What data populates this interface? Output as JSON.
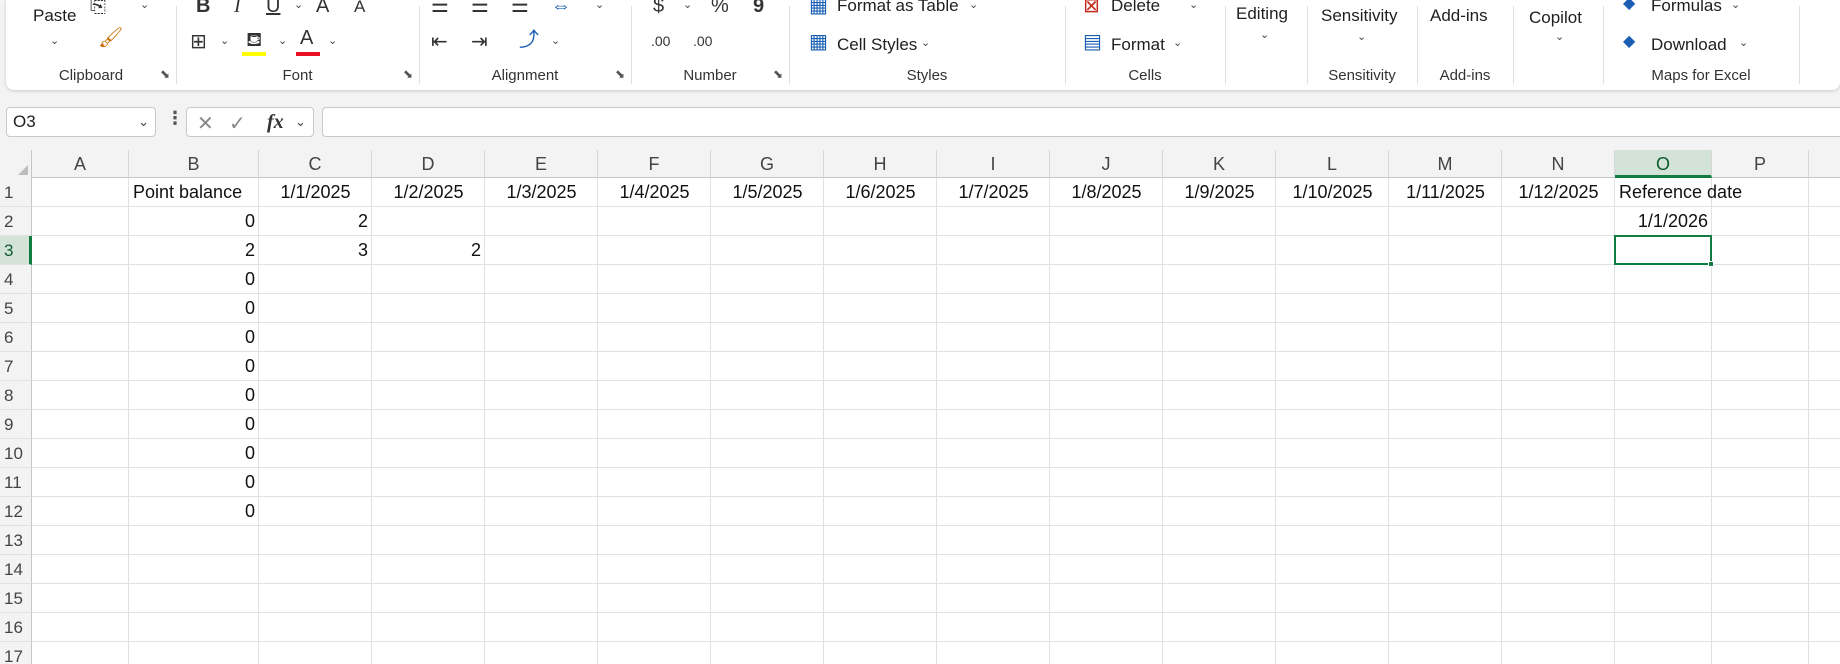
{
  "ribbon": {
    "clipboard": {
      "paste_label": "Paste",
      "group_label": "Clipboard"
    },
    "font": {
      "bold": "B",
      "italic": "I",
      "underline": "U",
      "grow": "A",
      "shrink": "A",
      "font_color_letter": "A",
      "group_label": "Font"
    },
    "alignment": {
      "group_label": "Alignment"
    },
    "number": {
      "currency": "$",
      "percent": "%",
      "comma": "9",
      "inc_decimal": ".00",
      "dec_decimal": ".00",
      "group_label": "Number"
    },
    "styles": {
      "format_table": "Format as Table",
      "cell_styles": "Cell Styles",
      "group_label": "Styles"
    },
    "cells": {
      "delete": "Delete",
      "format": "Format",
      "group_label": "Cells"
    },
    "editing": {
      "label": "Editing"
    },
    "sensitivity": {
      "label": "Sensitivity",
      "group_label": "Sensitivity"
    },
    "addins": {
      "label": "Add-ins",
      "group_label": "Add-ins"
    },
    "copilot": {
      "label": "Copilot"
    },
    "maps": {
      "formulas": "Formulas",
      "download": "Download",
      "group_label": "Maps for Excel"
    }
  },
  "formula_bar": {
    "name_box": "O3",
    "formula": ""
  },
  "columns": [
    "A",
    "B",
    "C",
    "D",
    "E",
    "F",
    "G",
    "H",
    "I",
    "J",
    "K",
    "L",
    "M",
    "N",
    "O",
    "P"
  ],
  "active_column": "O",
  "rows": [
    "1",
    "2",
    "3",
    "4",
    "5",
    "6",
    "7",
    "8",
    "9",
    "10",
    "11",
    "12",
    "13",
    "14",
    "15",
    "16",
    "17"
  ],
  "active_row": "3",
  "cells": {
    "B1": "Point balance",
    "C1": "1/1/2025",
    "D1": "1/2/2025",
    "E1": "1/3/2025",
    "F1": "1/4/2025",
    "G1": "1/5/2025",
    "H1": "1/6/2025",
    "I1": "1/7/2025",
    "J1": "1/8/2025",
    "K1": "1/9/2025",
    "L1": "1/10/2025",
    "M1": "1/11/2025",
    "N1": "1/12/2025",
    "O1": "Reference date",
    "B2": "0",
    "C2": "2",
    "O2": "1/1/2026",
    "B3": "2",
    "C3": "3",
    "D3": "2",
    "B4": "0",
    "B5": "0",
    "B6": "0",
    "B7": "0",
    "B8": "0",
    "B9": "0",
    "B10": "0",
    "B11": "0",
    "B12": "0"
  },
  "colors": {
    "accent": "#107c41",
    "font_color_bar": "#e81123",
    "highlight_bar": "#ffff00",
    "maps_icon": "#1a5fb4"
  }
}
